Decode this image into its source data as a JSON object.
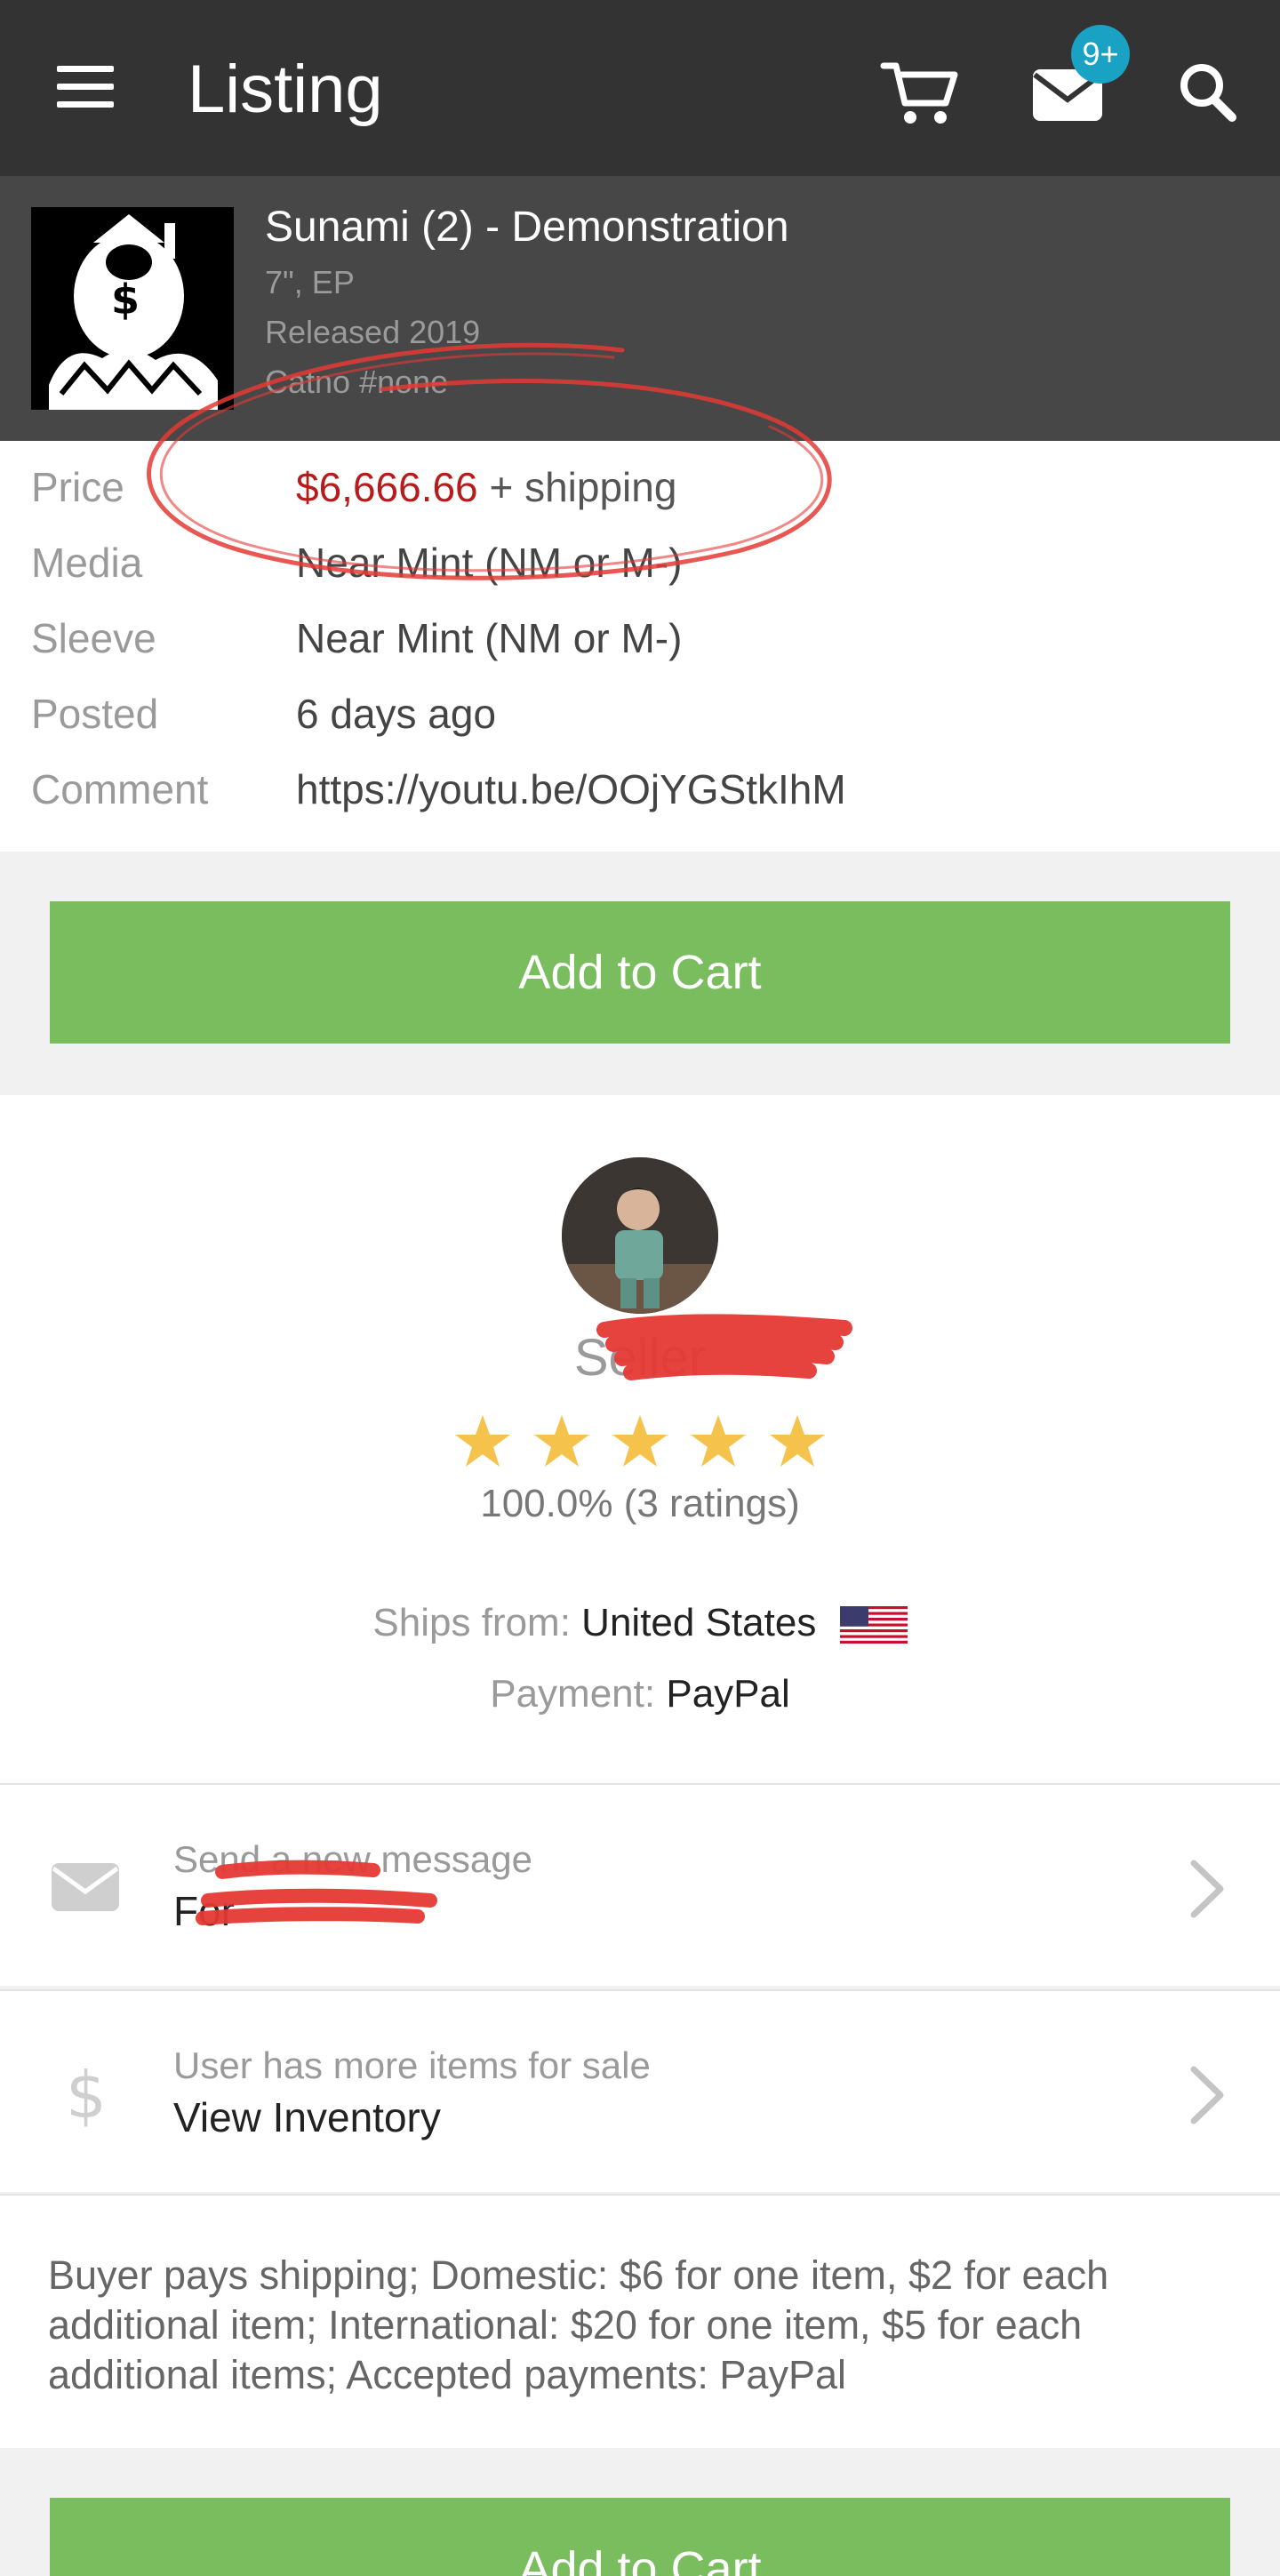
{
  "appbar": {
    "title": "Listing",
    "icons": [
      "menu-icon",
      "cart-icon",
      "mail-icon",
      "search-icon"
    ],
    "notification_badge": "9+"
  },
  "release": {
    "title": "Sunami (2) - Demonstration",
    "format": "7\", EP",
    "released": "Released 2019",
    "catno": "Catno #none"
  },
  "details": {
    "price_label": "Price",
    "price_amount": "$6,666.66",
    "price_suffix": "+ shipping",
    "media_label": "Media",
    "media_value": "Near Mint (NM or M-)",
    "sleeve_label": "Sleeve",
    "sleeve_value": "Near Mint (NM or M-)",
    "posted_label": "Posted",
    "posted_value": "6 days ago",
    "comment_label": "Comment",
    "comment_value": "https://youtu.be/OOjYGStkIhM"
  },
  "add_to_cart_label": "Add to Cart",
  "seller": {
    "name_label": "Seller",
    "rating_stars": 5,
    "rating_text": "100.0% (3 ratings)",
    "ships_from_label": "Ships from:",
    "ships_from_value": "United States",
    "payment_label": "Payment:",
    "payment_value": "PayPal"
  },
  "message_row": {
    "subtitle": "Send a new message",
    "title": "For"
  },
  "inventory_row": {
    "subtitle": "User has more items for sale",
    "title": "View Inventory"
  },
  "terms": "Buyer pays shipping; Domestic: $6 for one item, $2 for each additional item; International: $20 for one item, $5 for each additional items; Accepted payments: PayPal",
  "colors": {
    "appbar": "#333333",
    "release_header": "#474747",
    "price": "#b71c1c",
    "button": "#79bd5e",
    "badge": "#1aa2c4",
    "star": "#f5c24c",
    "annotation": "#e53935"
  }
}
